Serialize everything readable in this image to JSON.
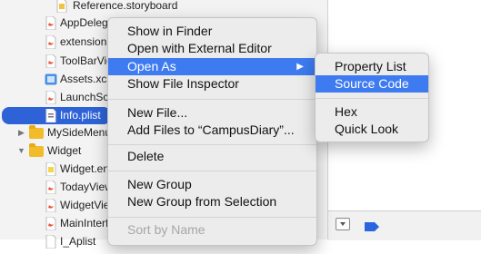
{
  "navigator": {
    "items": [
      {
        "label": "Reference.storyboard",
        "type": "storyboard"
      },
      {
        "label": "AppDelega",
        "type": "swift"
      },
      {
        "label": "extension.",
        "type": "swift"
      },
      {
        "label": "ToolBarVie",
        "type": "swift"
      },
      {
        "label": "Assets.xca",
        "type": "assets"
      },
      {
        "label": "LaunchScr",
        "type": "storyboard"
      },
      {
        "label": "Info.plist",
        "type": "plist",
        "selected": true
      },
      {
        "label": "MySideMenu",
        "type": "group"
      },
      {
        "label": "Widget",
        "type": "group"
      },
      {
        "label": "Widget.en",
        "type": "file"
      },
      {
        "label": "TodayView",
        "type": "swift"
      },
      {
        "label": "WidgetView",
        "type": "swift"
      },
      {
        "label": "MainInterf",
        "type": "storyboard"
      },
      {
        "label": "I_Aplist",
        "type": "plist"
      }
    ]
  },
  "context_menu": {
    "items": [
      {
        "label": "Show in Finder"
      },
      {
        "label": "Open with External Editor"
      },
      {
        "label": "Open As",
        "submenu": true,
        "highlighted": true
      },
      {
        "label": "Show File Inspector"
      },
      {
        "label": "New File..."
      },
      {
        "label": "Add Files to “CampusDiary”..."
      },
      {
        "label": "Delete"
      },
      {
        "label": "New Group"
      },
      {
        "label": "New Group from Selection"
      },
      {
        "label": "Sort by Name",
        "disabled": true
      }
    ]
  },
  "submenu": {
    "items": [
      {
        "label": "Property List"
      },
      {
        "label": "Source Code",
        "highlighted": true
      },
      {
        "label": "Hex"
      },
      {
        "label": "Quick Look"
      }
    ]
  },
  "colors": {
    "highlight": "#3e7bf0",
    "selection": "#2e63d7",
    "folder": "#f2bb2a"
  }
}
